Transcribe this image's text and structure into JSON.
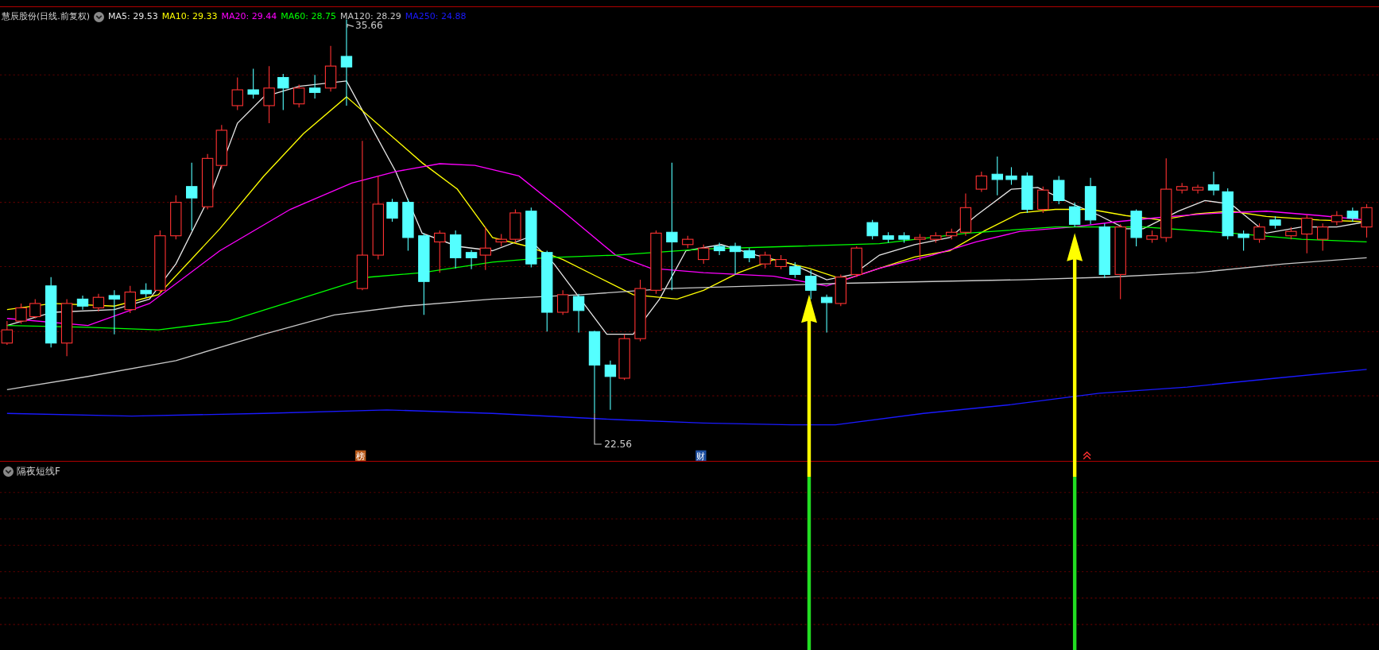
{
  "main_chart": {
    "title": "慧辰股份(日线.前复权)",
    "moving_averages": [
      {
        "text": "MA5: 29.53",
        "color": "#e6e6e6"
      },
      {
        "text": "MA10: 29.33",
        "color": "#ffff00"
      },
      {
        "text": "MA20: 29.44",
        "color": "#ff00ff"
      },
      {
        "text": "MA60: 28.75",
        "color": "#00ff00"
      },
      {
        "text": "MA120: 28.29",
        "color": "#c8c8c8"
      },
      {
        "text": "MA250: 24.88",
        "color": "#1a1aff"
      }
    ],
    "high_label": "35.66",
    "low_label": "22.56",
    "markers": [
      {
        "text": "榜",
        "color": "#b85a1a"
      },
      {
        "text": "财",
        "color": "#1e4fa0"
      }
    ]
  },
  "indicator_panel": {
    "title": "隔夜短线F"
  }
}
